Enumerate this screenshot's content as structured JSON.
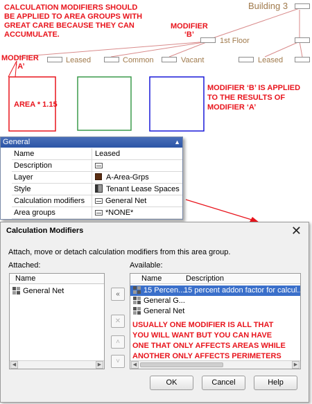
{
  "annotations": {
    "top_note_lines": [
      "CALCULATION MODIFIERS SHOULD",
      "BE APPLIED TO AREA GROUPS WITH",
      "GREAT CARE BECAUSE THEY CAN",
      "ACCUMULATE."
    ],
    "modifier_a_lines": [
      "MODIFIER",
      "‘A’"
    ],
    "modifier_b_lines": [
      "MODIFIER",
      "‘B’"
    ],
    "modifier_b_note_lines": [
      "MODIFIER ‘B’ IS APPLIED",
      "TO THE RESULTS OF",
      "MODIFIER ‘A’"
    ],
    "area_formula": "AREA * 1.15",
    "dialog_note_lines": [
      "USUALLY ONE MODIFIER IS ALL THAT",
      "YOU WILL WANT BUT YOU CAN HAVE",
      "ONE THAT ONLY AFFECTS AREAS WHILE",
      "ANOTHER ONLY AFFECTS PERIMETERS"
    ]
  },
  "diagram": {
    "building_label": "Building 3",
    "floor_label": "1st Floor",
    "group_labels": [
      "Leased",
      "Common",
      "Vacant"
    ],
    "right_label": "Leased",
    "colors": {
      "red": "#e8141c",
      "green": "#3a9a4a",
      "blue": "#1818d8",
      "tan": "#a07a4c"
    }
  },
  "properties": {
    "header": "General",
    "rows": [
      {
        "name": "Name",
        "value": "Leased"
      },
      {
        "name": "Description",
        "value": ""
      },
      {
        "name": "Layer",
        "value": "A-Area-Grps"
      },
      {
        "name": "Style",
        "value": "Tenant Lease Spaces"
      },
      {
        "name": "Calculation modifiers",
        "value": "General Net"
      },
      {
        "name": "Area groups",
        "value": "*NONE*"
      }
    ]
  },
  "dialog": {
    "title": "Calculation Modifiers",
    "instruction": "Attach, move or detach calculation modifiers from this area group.",
    "attached_label": "Attached:",
    "available_label": "Available:",
    "attached_header": "Name",
    "attached_items": [
      "General Net"
    ],
    "available_headers": {
      "name": "Name",
      "description": "Description"
    },
    "available_items": [
      {
        "name": "15 Percen...",
        "description": "15 percent addon factor for calcul..."
      },
      {
        "name": "General G...",
        "description": ""
      },
      {
        "name": "General Net",
        "description": ""
      }
    ],
    "buttons": {
      "ok": "OK",
      "cancel": "Cancel",
      "help": "Help"
    }
  }
}
